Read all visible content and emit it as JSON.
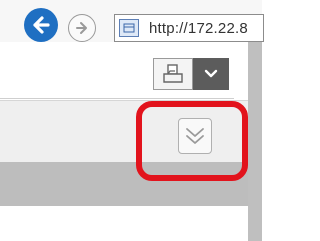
{
  "browser": {
    "url_text": "http://172.22.8",
    "back_icon": "arrow-left-icon",
    "forward_icon": "arrow-right-icon"
  },
  "toolbar": {
    "print_icon": "printer-icon",
    "dropdown_icon": "chevron-down-icon"
  },
  "panel": {
    "expand_icon": "double-chevron-down-icon"
  },
  "annotation": {
    "highlight_color": "#e2131c"
  },
  "colors": {
    "back_button": "#1f6fc2",
    "gray_band": "#bdbdbd",
    "dropdown_bg": "#5c5c5c"
  }
}
